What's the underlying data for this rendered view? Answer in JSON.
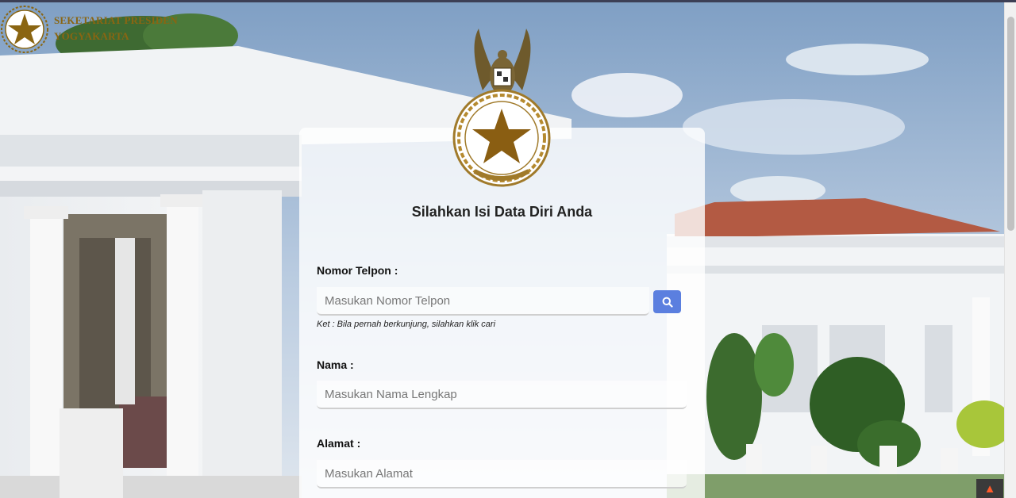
{
  "header": {
    "org_line1": "SEKETARIAT PRESIDEN",
    "org_line2": "YOGYAKARTA",
    "logo_icon": "star-emblem-icon"
  },
  "form": {
    "title": "Silahkan Isi Data Diri Anda",
    "phone_label": "Nomor Telpon :",
    "phone_placeholder": "Masukan Nomor Telpon",
    "phone_value": "",
    "search_icon": "search-icon",
    "phone_hint": "Ket : Bila pernah berkunjung, silahkan klik cari",
    "name_label": "Nama :",
    "name_placeholder": "Masukan Nama Lengkap",
    "name_value": "",
    "address_label": "Alamat :",
    "address_placeholder": "Masukan Alamat",
    "address_value": ""
  },
  "colors": {
    "brand_gold": "#8a6512",
    "button_blue": "#5b7fdf"
  }
}
